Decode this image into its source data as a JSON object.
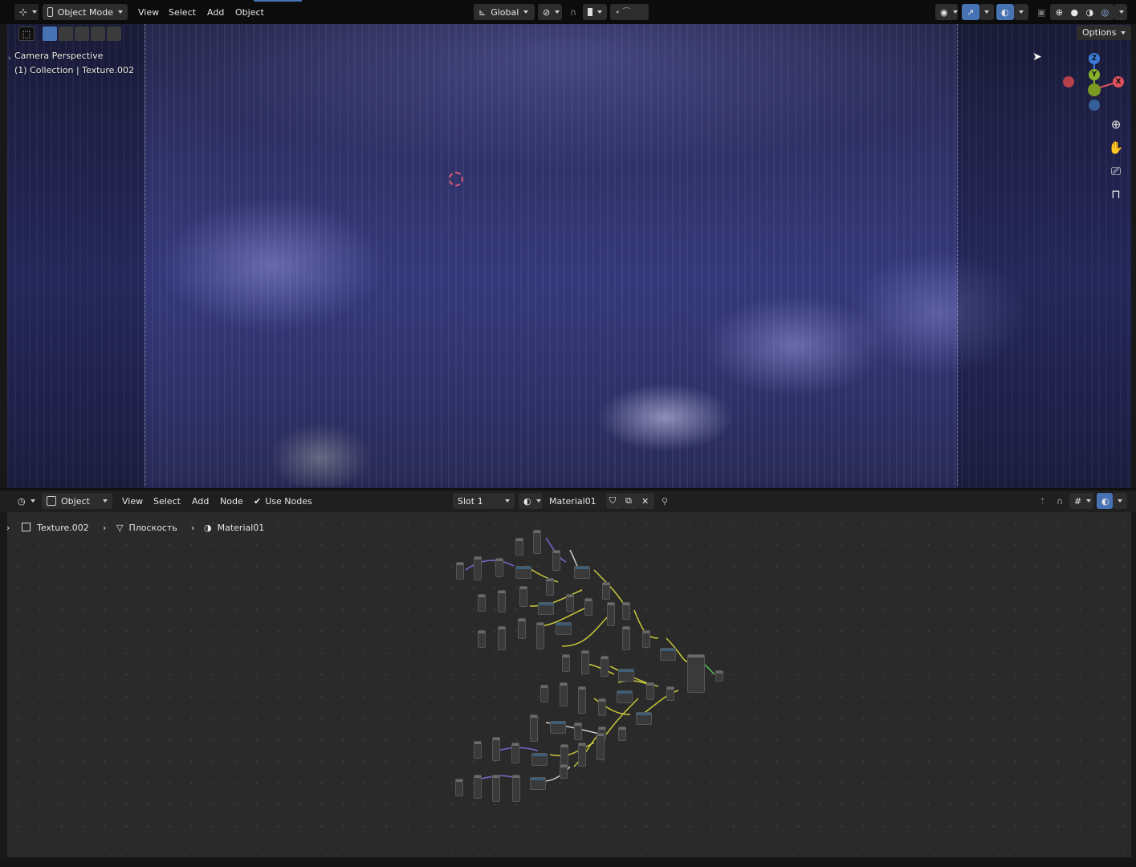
{
  "header_3d": {
    "mode": "Object Mode",
    "menus": [
      "View",
      "Select",
      "Add",
      "Object"
    ],
    "orientation": "Global",
    "overlay_labels": [
      "Options"
    ]
  },
  "viewport": {
    "line1": "Camera Perspective",
    "line2": "(1) Collection | Texture.002",
    "options_label": "Options",
    "gizmo": {
      "z": "Z",
      "y": "Y",
      "x": "X"
    }
  },
  "header_node": {
    "mode": "Object",
    "menus": [
      "View",
      "Select",
      "Add",
      "Node"
    ],
    "use_nodes_label": "Use Nodes",
    "use_nodes_checked": true,
    "slot": "Slot 1",
    "material": "Material01"
  },
  "breadcrumbs": {
    "object": "Texture.002",
    "mesh": "Плоскость",
    "material": "Material01"
  },
  "colors": {
    "accent": "#4772b3",
    "x_axis": "#e0505a",
    "y_axis": "#8ab32b",
    "z_axis": "#3c7bd8",
    "link_yellow": "#c8c83a",
    "link_purple": "#7a6ad0",
    "link_green": "#5ac85a"
  }
}
